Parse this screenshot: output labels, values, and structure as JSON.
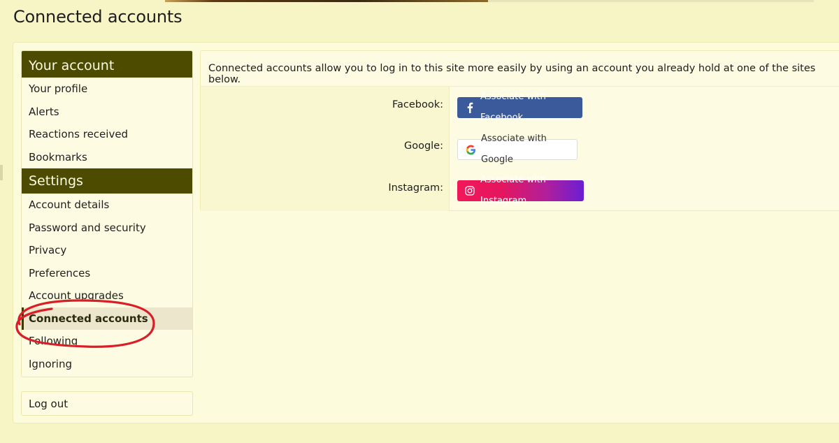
{
  "page": {
    "title": "Connected accounts"
  },
  "sidebar": {
    "account_header": "Your account",
    "account_items": [
      {
        "label": "Your profile"
      },
      {
        "label": "Alerts"
      },
      {
        "label": "Reactions received"
      },
      {
        "label": "Bookmarks"
      }
    ],
    "settings_header": "Settings",
    "settings_items": [
      {
        "label": "Account details"
      },
      {
        "label": "Password and security"
      },
      {
        "label": "Privacy"
      },
      {
        "label": "Preferences"
      },
      {
        "label": "Account upgrades"
      },
      {
        "label": "Connected accounts",
        "active": true
      },
      {
        "label": "Following"
      },
      {
        "label": "Ignoring"
      }
    ],
    "logout": "Log out"
  },
  "main": {
    "intro": "Connected accounts allow you to log in to this site more easily by using an account you already hold at one of the sites below.",
    "providers": [
      {
        "label": "Facebook:",
        "button": "Associate with Facebook",
        "icon": "facebook-icon",
        "color": "#3b5a9c"
      },
      {
        "label": "Google:",
        "button": "Associate with Google",
        "icon": "google-icon",
        "color": "#ffffff"
      },
      {
        "label": "Instagram:",
        "button": "Associate with Instagram",
        "icon": "instagram-icon",
        "color": "#e4165e"
      }
    ]
  },
  "colors": {
    "background": "#f7f5c6",
    "panel": "#fdfce2",
    "header": "#4d4b00",
    "annotation": "#d81e27"
  }
}
